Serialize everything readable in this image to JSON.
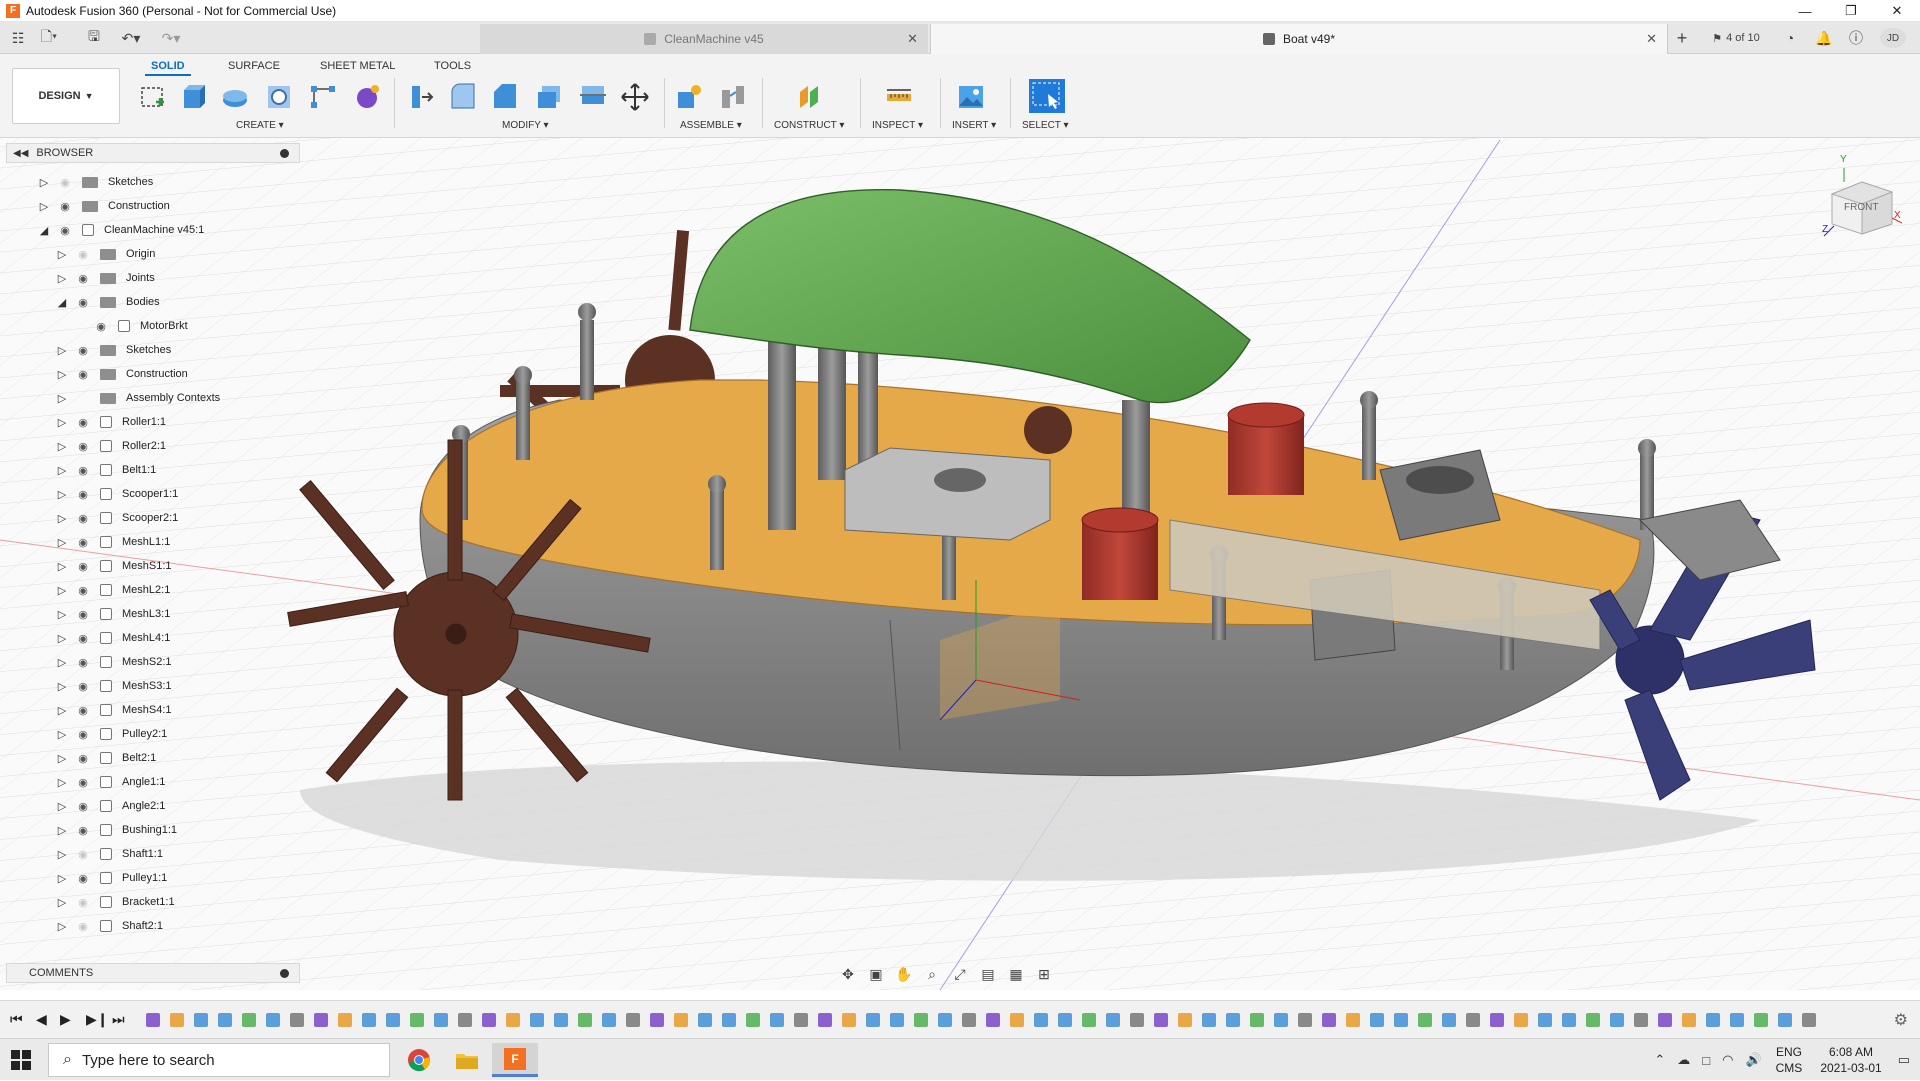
{
  "titlebar": {
    "title": "Autodesk Fusion 360 (Personal - Not for Commercial Use)",
    "logo": "F"
  },
  "tabs": [
    {
      "label": "CleanMachine v45",
      "active": false
    },
    {
      "label": "Boat v49*",
      "active": true
    }
  ],
  "tab_counter": "4 of 10",
  "user_initials": "JD",
  "workspace_tabs": [
    "SOLID",
    "SURFACE",
    "SHEET METAL",
    "TOOLS"
  ],
  "design_label": "DESIGN",
  "tool_groups": [
    "CREATE",
    "MODIFY",
    "ASSEMBLE",
    "CONSTRUCT",
    "INSPECT",
    "INSERT",
    "SELECT"
  ],
  "browser": {
    "title": "BROWSER",
    "rows": [
      {
        "label": "Sketches",
        "indent": 1,
        "tri": "right",
        "type": "folder",
        "visible": false
      },
      {
        "label": "Construction",
        "indent": 1,
        "tri": "right",
        "type": "folder",
        "visible": true
      },
      {
        "label": "CleanMachine v45:1",
        "indent": 1,
        "tri": "down",
        "type": "component",
        "visible": true
      },
      {
        "label": "Origin",
        "indent": 2,
        "tri": "right",
        "type": "folder",
        "visible": false
      },
      {
        "label": "Joints",
        "indent": 2,
        "tri": "right",
        "type": "folder",
        "visible": true
      },
      {
        "label": "Bodies",
        "indent": 2,
        "tri": "down",
        "type": "folder",
        "visible": true
      },
      {
        "label": "MotorBrkt",
        "indent": 3,
        "tri": "none",
        "type": "body",
        "visible": true
      },
      {
        "label": "Sketches",
        "indent": 2,
        "tri": "right",
        "type": "folder",
        "visible": true
      },
      {
        "label": "Construction",
        "indent": 2,
        "tri": "right",
        "type": "folder",
        "visible": true
      },
      {
        "label": "Assembly Contexts",
        "indent": 2,
        "tri": "right",
        "type": "folder",
        "visible": null
      },
      {
        "label": "Roller1:1",
        "indent": 2,
        "tri": "right",
        "type": "component",
        "visible": true
      },
      {
        "label": "Roller2:1",
        "indent": 2,
        "tri": "right",
        "type": "component",
        "visible": true
      },
      {
        "label": "Belt1:1",
        "indent": 2,
        "tri": "right",
        "type": "component",
        "visible": true
      },
      {
        "label": "Scooper1:1",
        "indent": 2,
        "tri": "right",
        "type": "component",
        "visible": true
      },
      {
        "label": "Scooper2:1",
        "indent": 2,
        "tri": "right",
        "type": "component",
        "visible": true
      },
      {
        "label": "MeshL1:1",
        "indent": 2,
        "tri": "right",
        "type": "component",
        "visible": true
      },
      {
        "label": "MeshS1:1",
        "indent": 2,
        "tri": "right",
        "type": "component",
        "visible": true
      },
      {
        "label": "MeshL2:1",
        "indent": 2,
        "tri": "right",
        "type": "component",
        "visible": true
      },
      {
        "label": "MeshL3:1",
        "indent": 2,
        "tri": "right",
        "type": "component",
        "visible": true
      },
      {
        "label": "MeshL4:1",
        "indent": 2,
        "tri": "right",
        "type": "component",
        "visible": true
      },
      {
        "label": "MeshS2:1",
        "indent": 2,
        "tri": "right",
        "type": "component",
        "visible": true
      },
      {
        "label": "MeshS3:1",
        "indent": 2,
        "tri": "right",
        "type": "component",
        "visible": true
      },
      {
        "label": "MeshS4:1",
        "indent": 2,
        "tri": "right",
        "type": "component",
        "visible": true
      },
      {
        "label": "Pulley2:1",
        "indent": 2,
        "tri": "right",
        "type": "component",
        "visible": true
      },
      {
        "label": "Belt2:1",
        "indent": 2,
        "tri": "right",
        "type": "component",
        "visible": true
      },
      {
        "label": "Angle1:1",
        "indent": 2,
        "tri": "right",
        "type": "component",
        "visible": true
      },
      {
        "label": "Angle2:1",
        "indent": 2,
        "tri": "right",
        "type": "component",
        "visible": true
      },
      {
        "label": "Bushing1:1",
        "indent": 2,
        "tri": "right",
        "type": "component",
        "visible": true
      },
      {
        "label": "Shaft1:1",
        "indent": 2,
        "tri": "right",
        "type": "component",
        "visible": false
      },
      {
        "label": "Pulley1:1",
        "indent": 2,
        "tri": "right",
        "type": "component",
        "visible": true
      },
      {
        "label": "Bracket1:1",
        "indent": 2,
        "tri": "right",
        "type": "component",
        "visible": false
      },
      {
        "label": "Shaft2:1",
        "indent": 2,
        "tri": "right",
        "type": "component",
        "visible": false
      }
    ]
  },
  "comments_title": "COMMENTS",
  "viewcube_label": "FRONT",
  "axis_labels": {
    "y": "Y",
    "z": "Z",
    "x": "X"
  },
  "taskbar": {
    "search_placeholder": "Type here to search",
    "lang_line1": "ENG",
    "lang_line2": "CMS",
    "time": "6:08 AM",
    "date": "2021-03-01"
  },
  "colors": {
    "accent": "#0a6fc2",
    "deck": "#e6a94a",
    "hull": "#8d8d8d",
    "canopy": "#5fa14f",
    "wheel": "#5b3124",
    "barrel": "#a8342a",
    "propeller": "#3a3f7a"
  }
}
